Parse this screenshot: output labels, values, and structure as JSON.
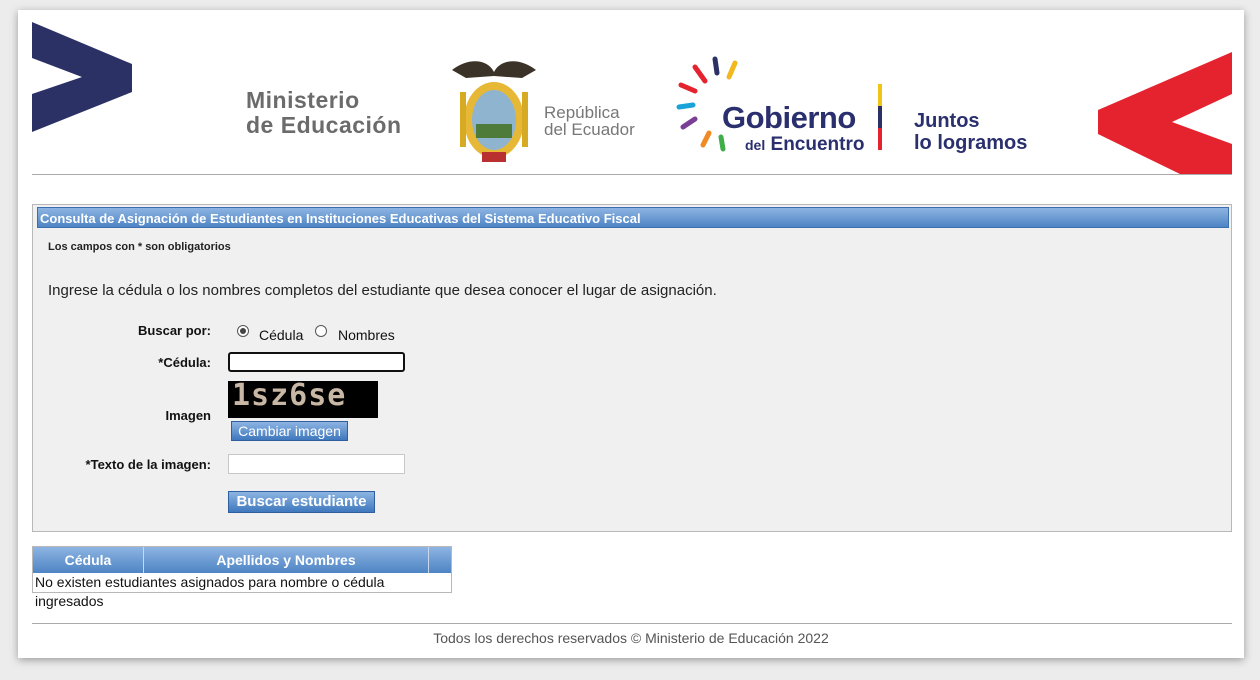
{
  "header": {
    "ministry_line1": "Ministerio",
    "ministry_line2": "de Educación",
    "republic_line1": "República",
    "republic_line2": "del Ecuador",
    "gobierno_title": "Gobierno",
    "gobierno_sub_small": "del",
    "gobierno_sub": "Encuentro",
    "slogan_line1": "Juntos",
    "slogan_line2": "lo logramos",
    "colors": {
      "navy": "#2b3165",
      "red": "#e5232f",
      "gray_text": "#6b6b6b"
    }
  },
  "form": {
    "panel_title": "Consulta de Asignación de Estudiantes en Instituciones Educativas del Sistema Educativo Fiscal",
    "required_note": "Los campos con * son obligatorios",
    "instructions": "Ingrese la cédula o los nombres completos del estudiante que desea conocer el lugar de asignación.",
    "search_by_label": "Buscar por:",
    "options": [
      {
        "label": "Cédula",
        "selected": true
      },
      {
        "label": "Nombres",
        "selected": false
      }
    ],
    "cedula_label": "*Cédula:",
    "cedula_value": "",
    "image_label": "Imagen",
    "captcha_text": "1sz6se",
    "change_image_label": "Cambiar imagen",
    "captcha_input_label": "*Texto de la imagen:",
    "captcha_input_value": "",
    "submit_label": "Buscar estudiante"
  },
  "results": {
    "columns": [
      "Cédula",
      "Apellidos y Nombres",
      ""
    ],
    "empty_message": "No existen estudiantes asignados para nombre o cédula ingresados"
  },
  "footer": {
    "text": "Todos los derechos reservados © Ministerio de Educación 2022"
  }
}
